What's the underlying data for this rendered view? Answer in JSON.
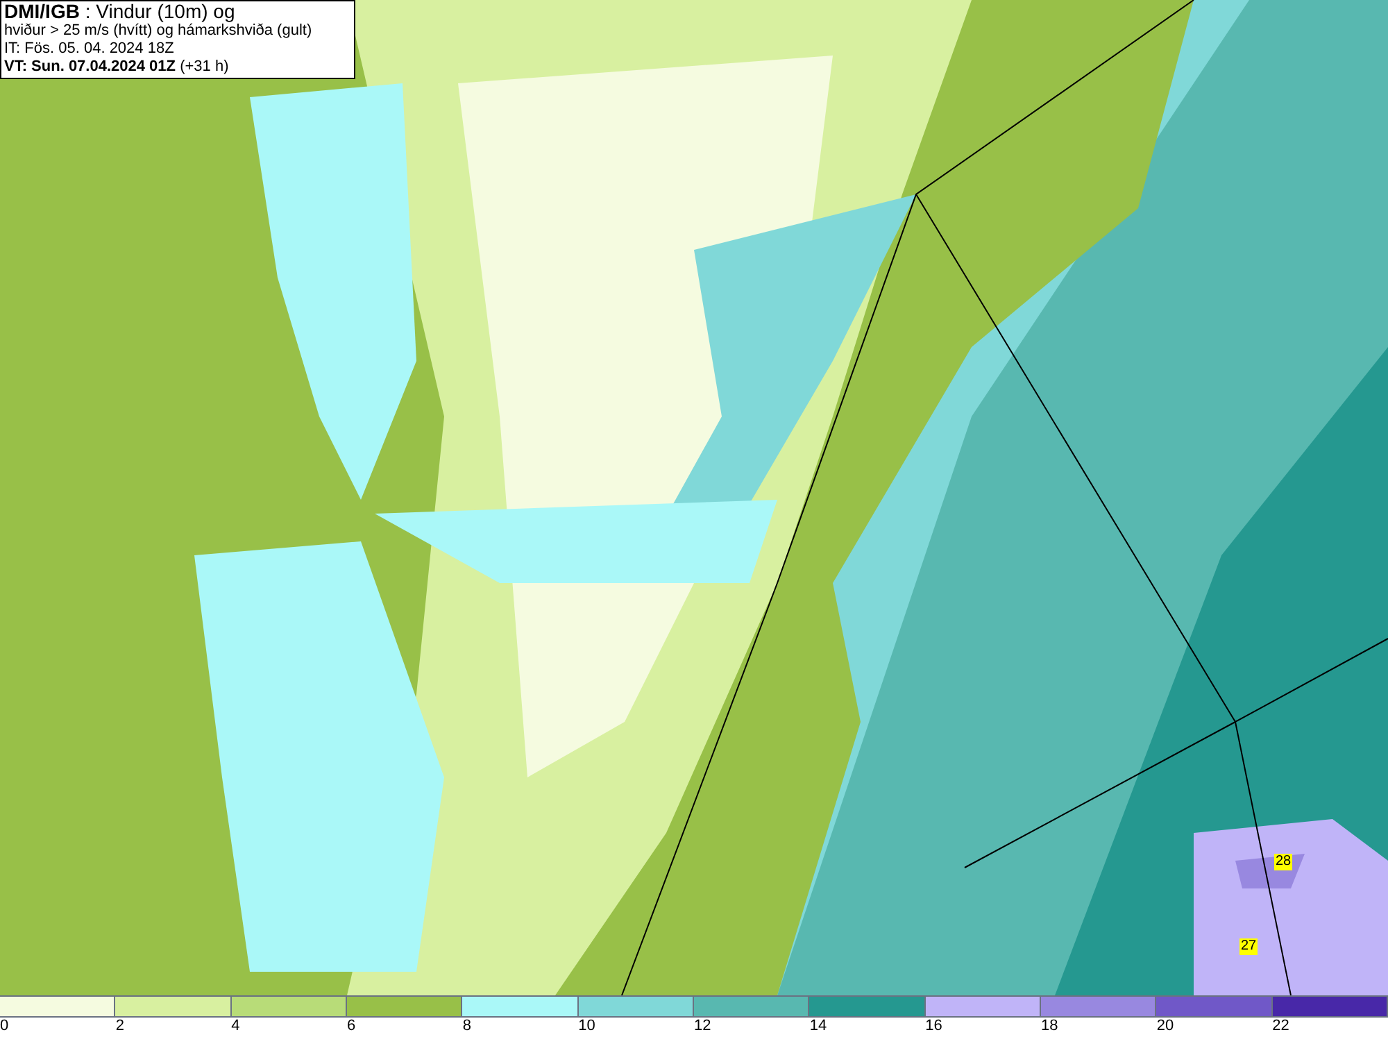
{
  "header": {
    "lines": [
      "**DMI/IGB** : Vindur (10m) og",
      "hviður > 25 m/s (hvítt) og hámarkshviða (gult)",
      "IT: Fös. 05. 04. 2024 18Z",
      "**VT: Sun. 07.04.2024 01Z** (+31 h)"
    ]
  },
  "gust_labels": [
    {
      "value": "28"
    },
    {
      "value": "27"
    }
  ],
  "legend": [
    {
      "label": "0",
      "color": "#f5fbe0"
    },
    {
      "label": "2",
      "color": "#d8f0a0"
    },
    {
      "label": "4",
      "color": "#b8dc78"
    },
    {
      "label": "6",
      "color": "#98c048"
    },
    {
      "label": "8",
      "color": "#aaf8f8"
    },
    {
      "label": "10",
      "color": "#80d8d8"
    },
    {
      "label": "12",
      "color": "#58b8b0"
    },
    {
      "label": "14",
      "color": "#259890"
    },
    {
      "label": "16",
      "color": "#c0b4f8"
    },
    {
      "label": "18",
      "color": "#9888e0"
    },
    {
      "label": "20",
      "color": "#7058c8"
    },
    {
      "label": "22",
      "color": "#4828a8"
    }
  ]
}
